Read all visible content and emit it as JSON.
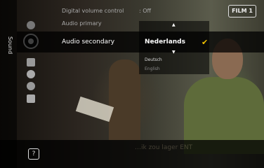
{
  "channel_logo": "FILM 1",
  "sidebar": {
    "title": "Sound"
  },
  "settings": [
    {
      "label": "Digital volume control",
      "value": ": Off"
    },
    {
      "label": "Audio primary",
      "value": ""
    },
    {
      "label": "Audio secondary",
      "value": ""
    }
  ],
  "dropdown": {
    "selected": "Nederlands",
    "options": [
      "Deutsch",
      "English"
    ]
  },
  "help_label": "?",
  "ghost_subtitle": "…ik zou lager ENT",
  "icons": [
    "sound-icon",
    "speaker-icon",
    "picture-icon",
    "gear-icon",
    "globe-icon",
    "card-icon"
  ]
}
